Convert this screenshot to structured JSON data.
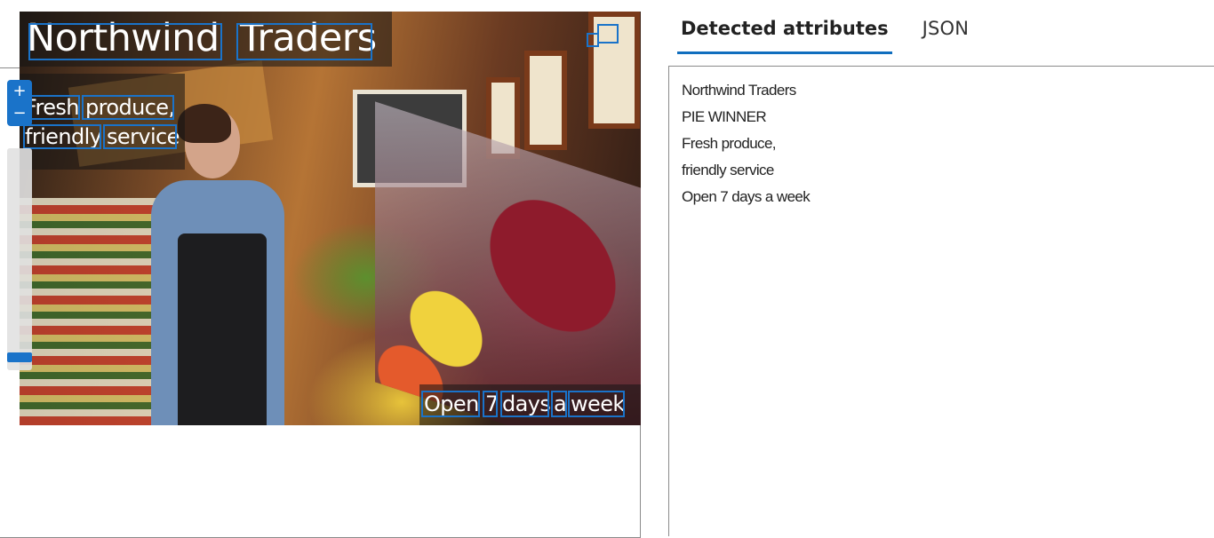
{
  "tabs": [
    {
      "label": "Detected attributes",
      "active": true
    },
    {
      "label": "JSON",
      "active": false
    }
  ],
  "viewer": {
    "zoom": {
      "in_symbol": "+",
      "out_symbol": "−",
      "level": 0.08
    },
    "image_texts": {
      "title_words": [
        "Northwind",
        "Traders"
      ],
      "tagline_line1": [
        "Fresh",
        "produce,"
      ],
      "tagline_line2": [
        "friendly",
        "service"
      ],
      "hours_words": [
        "Open",
        "7",
        "days",
        "a",
        "week"
      ],
      "sign_word": "PIE WINNER"
    }
  },
  "attributes": [
    "Northwind Traders",
    "PIE WINNER",
    "Fresh produce,",
    "friendly service",
    "Open 7 days a week"
  ],
  "colors": {
    "accent": "#1a73c9",
    "tab_underline": "#106ebe"
  }
}
